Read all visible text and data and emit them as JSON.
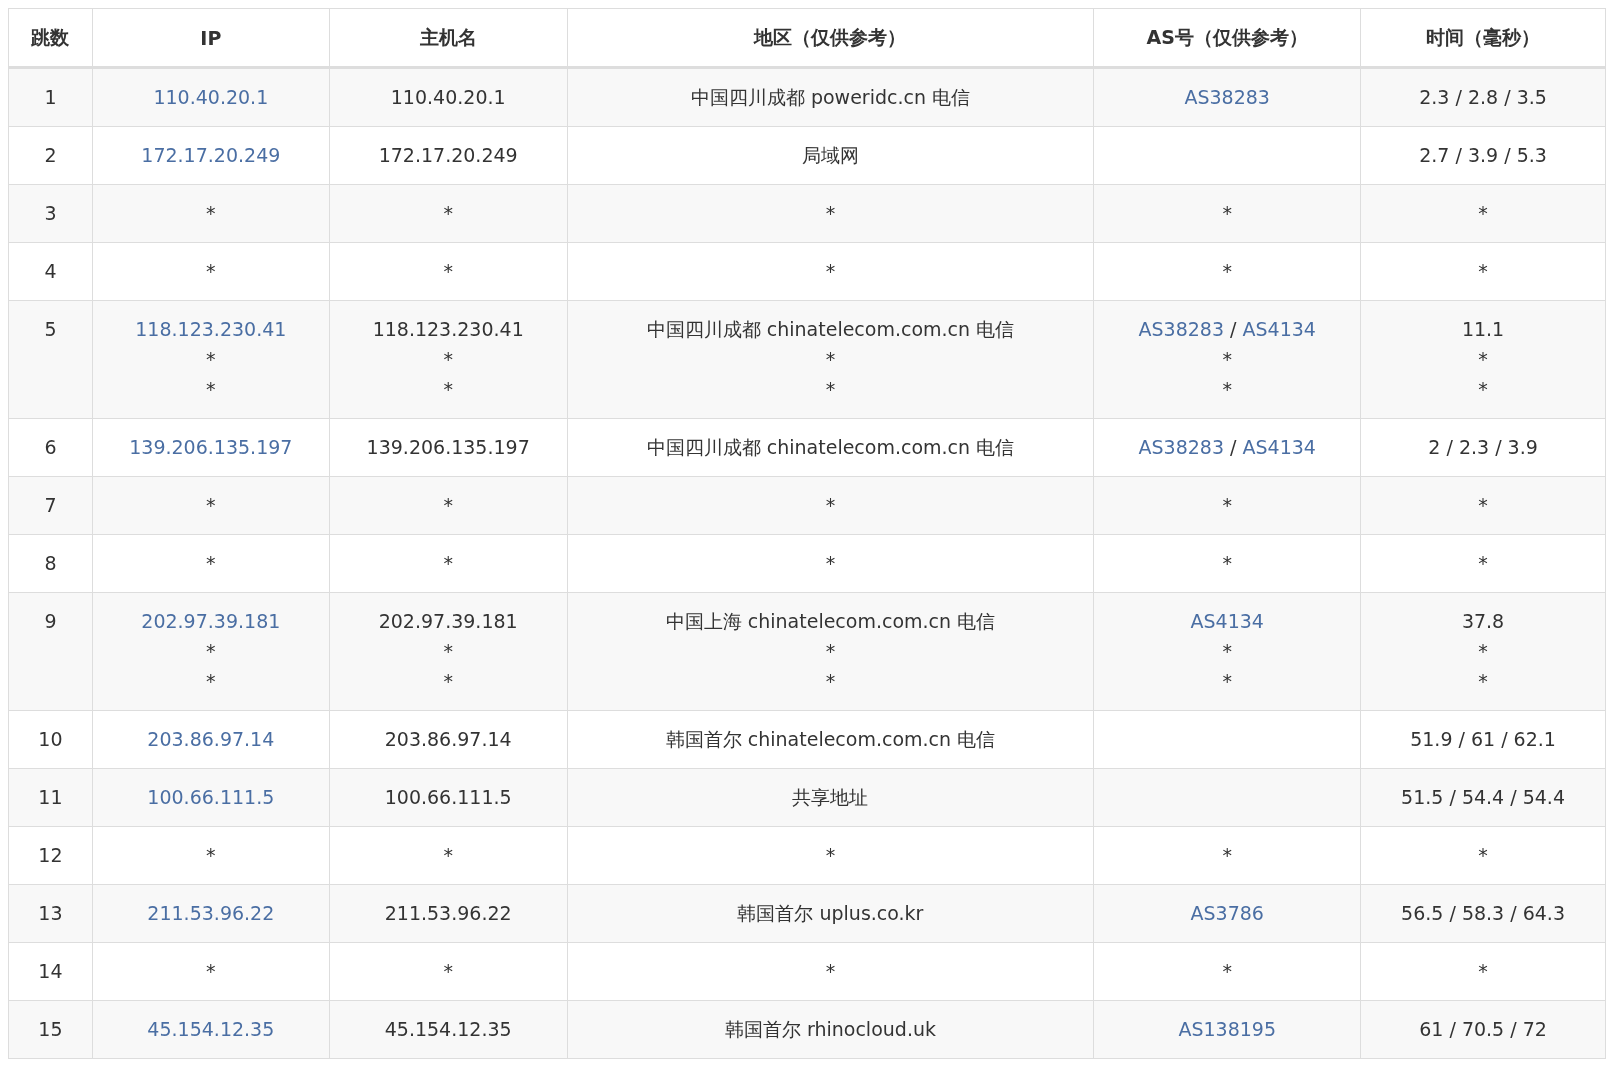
{
  "table": {
    "columns": [
      "跳数",
      "IP",
      "主机名",
      "地区（仅供参考）",
      "AS号（仅供参考）",
      "时间（毫秒）"
    ],
    "rows": [
      {
        "hop": "1",
        "ip": [
          [
            {
              "link": "110.40.20.1"
            }
          ]
        ],
        "host": [
          [
            "110.40.20.1"
          ]
        ],
        "region": [
          [
            "中国四川成都 poweridc.cn 电信"
          ]
        ],
        "as": [
          [
            {
              "link": "AS38283"
            }
          ]
        ],
        "time": [
          [
            "2.3 / 2.8 / 3.5"
          ]
        ]
      },
      {
        "hop": "2",
        "ip": [
          [
            {
              "link": "172.17.20.249"
            }
          ]
        ],
        "host": [
          [
            "172.17.20.249"
          ]
        ],
        "region": [
          [
            "局域网"
          ]
        ],
        "as": [],
        "time": [
          [
            "2.7 / 3.9 / 5.3"
          ]
        ]
      },
      {
        "hop": "3",
        "ip": [
          [
            "*"
          ]
        ],
        "host": [
          [
            "*"
          ]
        ],
        "region": [
          [
            "*"
          ]
        ],
        "as": [
          [
            "*"
          ]
        ],
        "time": [
          [
            "*"
          ]
        ]
      },
      {
        "hop": "4",
        "ip": [
          [
            "*"
          ]
        ],
        "host": [
          [
            "*"
          ]
        ],
        "region": [
          [
            "*"
          ]
        ],
        "as": [
          [
            "*"
          ]
        ],
        "time": [
          [
            "*"
          ]
        ]
      },
      {
        "hop": "5",
        "ip": [
          [
            {
              "link": "118.123.230.41"
            }
          ],
          [
            "*"
          ],
          [
            "*"
          ]
        ],
        "host": [
          [
            "118.123.230.41"
          ],
          [
            "*"
          ],
          [
            "*"
          ]
        ],
        "region": [
          [
            "中国四川成都 chinatelecom.com.cn 电信"
          ],
          [
            "*"
          ],
          [
            "*"
          ]
        ],
        "as": [
          [
            {
              "link": "AS38283"
            },
            "/",
            {
              "link": "AS4134"
            }
          ],
          [
            "*"
          ],
          [
            "*"
          ]
        ],
        "time": [
          [
            "11.1"
          ],
          [
            "*"
          ],
          [
            "*"
          ]
        ]
      },
      {
        "hop": "6",
        "ip": [
          [
            {
              "link": "139.206.135.197"
            }
          ]
        ],
        "host": [
          [
            "139.206.135.197"
          ]
        ],
        "region": [
          [
            "中国四川成都 chinatelecom.com.cn 电信"
          ]
        ],
        "as": [
          [
            {
              "link": "AS38283"
            },
            "/",
            {
              "link": "AS4134"
            }
          ]
        ],
        "time": [
          [
            "2 / 2.3 / 3.9"
          ]
        ]
      },
      {
        "hop": "7",
        "ip": [
          [
            "*"
          ]
        ],
        "host": [
          [
            "*"
          ]
        ],
        "region": [
          [
            "*"
          ]
        ],
        "as": [
          [
            "*"
          ]
        ],
        "time": [
          [
            "*"
          ]
        ]
      },
      {
        "hop": "8",
        "ip": [
          [
            "*"
          ]
        ],
        "host": [
          [
            "*"
          ]
        ],
        "region": [
          [
            "*"
          ]
        ],
        "as": [
          [
            "*"
          ]
        ],
        "time": [
          [
            "*"
          ]
        ]
      },
      {
        "hop": "9",
        "ip": [
          [
            {
              "link": "202.97.39.181"
            }
          ],
          [
            "*"
          ],
          [
            "*"
          ]
        ],
        "host": [
          [
            "202.97.39.181"
          ],
          [
            "*"
          ],
          [
            "*"
          ]
        ],
        "region": [
          [
            "中国上海 chinatelecom.com.cn 电信"
          ],
          [
            "*"
          ],
          [
            "*"
          ]
        ],
        "as": [
          [
            {
              "link": "AS4134"
            }
          ],
          [
            "*"
          ],
          [
            "*"
          ]
        ],
        "time": [
          [
            "37.8"
          ],
          [
            "*"
          ],
          [
            "*"
          ]
        ]
      },
      {
        "hop": "10",
        "ip": [
          [
            {
              "link": "203.86.97.14"
            }
          ]
        ],
        "host": [
          [
            "203.86.97.14"
          ]
        ],
        "region": [
          [
            "韩国首尔 chinatelecom.com.cn 电信"
          ]
        ],
        "as": [],
        "time": [
          [
            "51.9 / 61 / 62.1"
          ]
        ]
      },
      {
        "hop": "11",
        "ip": [
          [
            {
              "link": "100.66.111.5"
            }
          ]
        ],
        "host": [
          [
            "100.66.111.5"
          ]
        ],
        "region": [
          [
            "共享地址"
          ]
        ],
        "as": [],
        "time": [
          [
            "51.5 / 54.4 / 54.4"
          ]
        ]
      },
      {
        "hop": "12",
        "ip": [
          [
            "*"
          ]
        ],
        "host": [
          [
            "*"
          ]
        ],
        "region": [
          [
            "*"
          ]
        ],
        "as": [
          [
            "*"
          ]
        ],
        "time": [
          [
            "*"
          ]
        ]
      },
      {
        "hop": "13",
        "ip": [
          [
            {
              "link": "211.53.96.22"
            }
          ]
        ],
        "host": [
          [
            "211.53.96.22"
          ]
        ],
        "region": [
          [
            "韩国首尔 uplus.co.kr"
          ]
        ],
        "as": [
          [
            {
              "link": "AS3786"
            }
          ]
        ],
        "time": [
          [
            "56.5 / 58.3 / 64.3"
          ]
        ]
      },
      {
        "hop": "14",
        "ip": [
          [
            "*"
          ]
        ],
        "host": [
          [
            "*"
          ]
        ],
        "region": [
          [
            "*"
          ]
        ],
        "as": [
          [
            "*"
          ]
        ],
        "time": [
          [
            "*"
          ]
        ]
      },
      {
        "hop": "15",
        "ip": [
          [
            {
              "link": "45.154.12.35"
            }
          ]
        ],
        "host": [
          [
            "45.154.12.35"
          ]
        ],
        "region": [
          [
            "韩国首尔 rhinocloud.uk"
          ]
        ],
        "as": [
          [
            {
              "link": "AS138195"
            }
          ]
        ],
        "time": [
          [
            "61 / 70.5 / 72"
          ]
        ]
      }
    ]
  }
}
